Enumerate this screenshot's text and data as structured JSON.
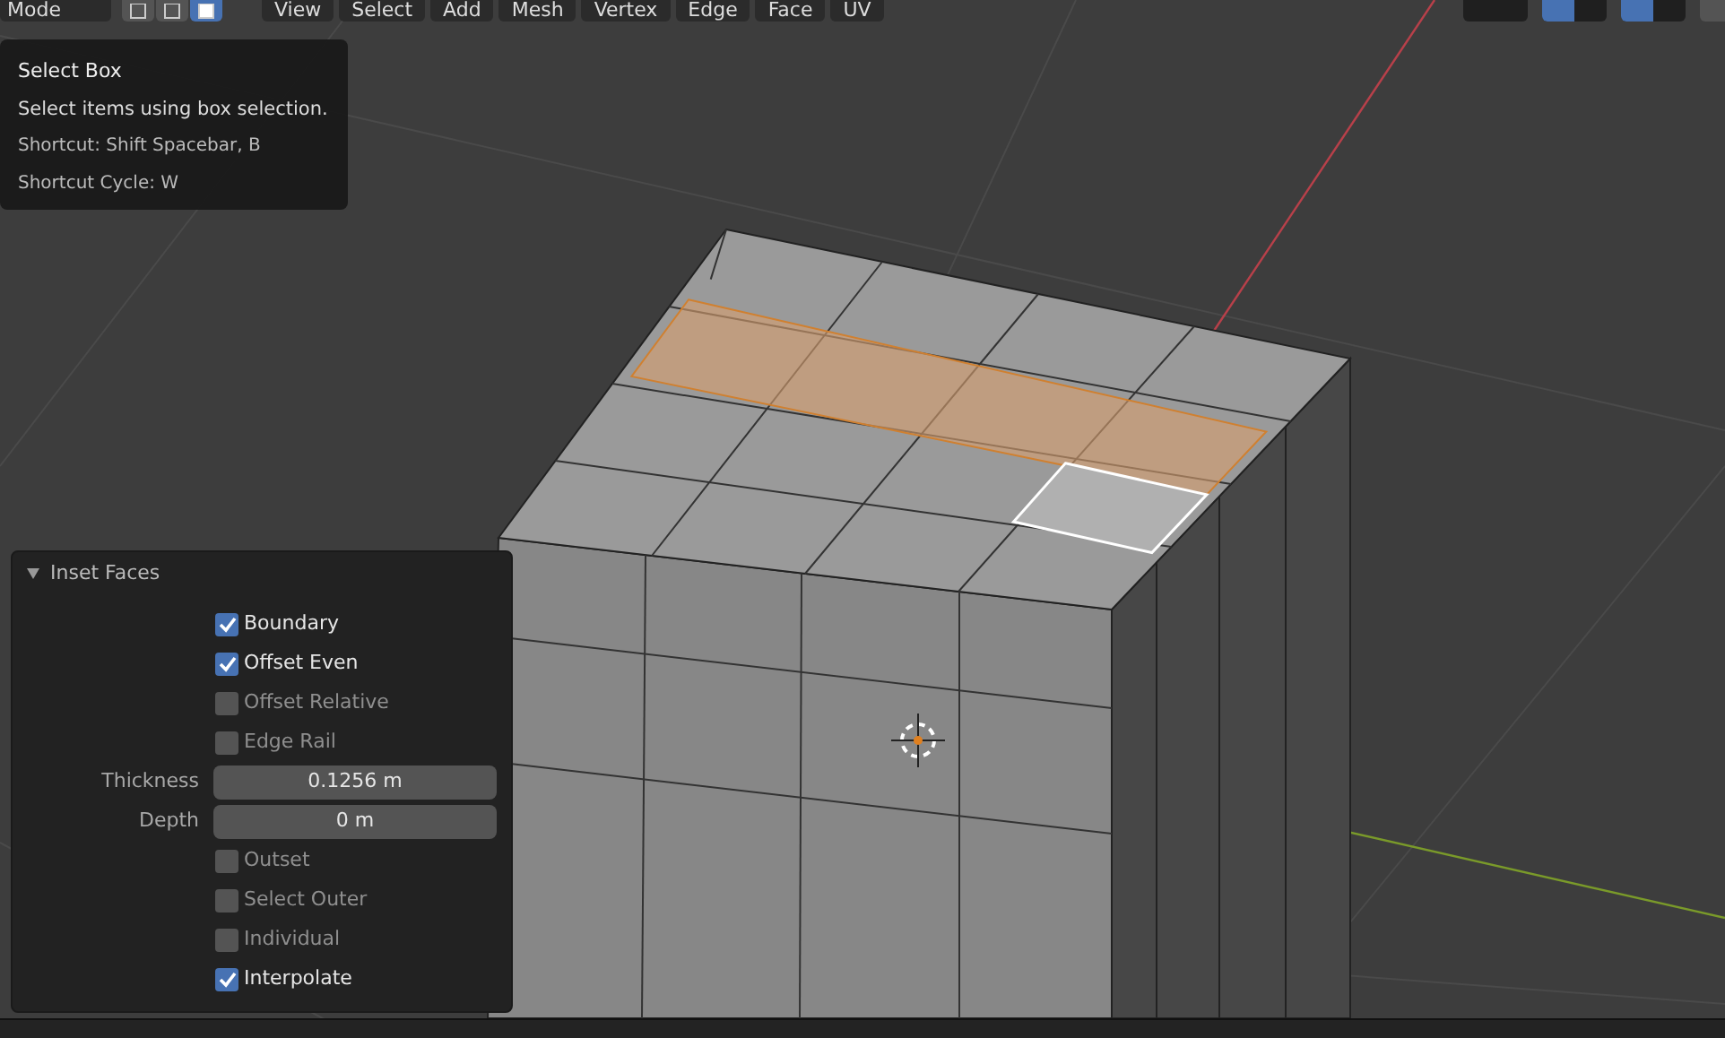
{
  "header": {
    "mode": "Mode",
    "select_modes": [
      {
        "selected": false
      },
      {
        "selected": false
      },
      {
        "selected": true
      }
    ],
    "menus": [
      "View",
      "Select",
      "Add",
      "Mesh",
      "Vertex",
      "Edge",
      "Face",
      "UV"
    ]
  },
  "tooltip": {
    "title": "Select Box",
    "description": "Select items using box selection.",
    "lines": [
      "Shortcut: Shift Spacebar, B",
      "Shortcut Cycle: W"
    ]
  },
  "operator_panel": {
    "title": "Inset Faces",
    "expanded": true,
    "properties": [
      {
        "kind": "checkbox",
        "label": "Boundary",
        "checked": true
      },
      {
        "kind": "checkbox",
        "label": "Offset Even",
        "checked": true
      },
      {
        "kind": "checkbox",
        "label": "Offset Relative",
        "checked": false
      },
      {
        "kind": "checkbox",
        "label": "Edge Rail",
        "checked": false
      },
      {
        "kind": "number",
        "label": "Thickness",
        "value": "0.1256 m"
      },
      {
        "kind": "number",
        "label": "Depth",
        "value": "0 m"
      },
      {
        "kind": "checkbox",
        "label": "Outset",
        "checked": false
      },
      {
        "kind": "checkbox",
        "label": "Select Outer",
        "checked": false
      },
      {
        "kind": "checkbox",
        "label": "Individual",
        "checked": false
      },
      {
        "kind": "checkbox",
        "label": "Interpolate",
        "checked": true
      }
    ]
  }
}
